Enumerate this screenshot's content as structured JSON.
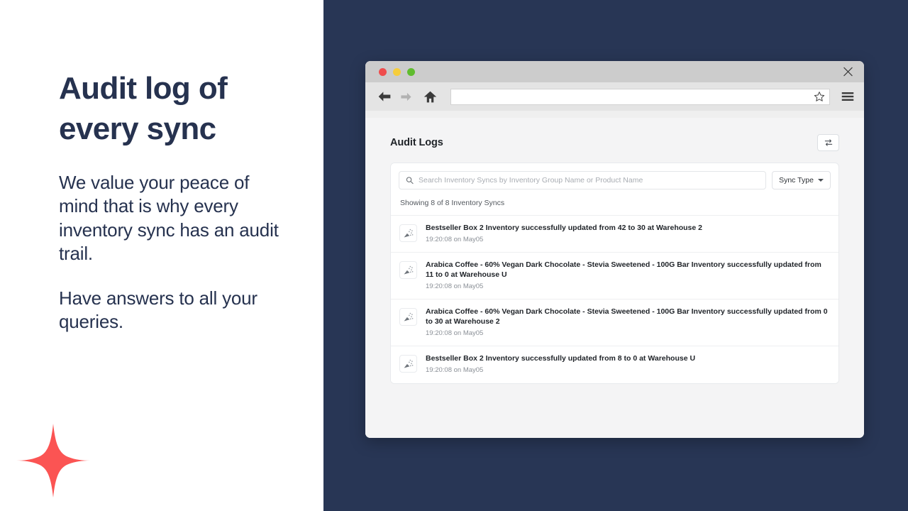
{
  "slide": {
    "headline": "Audit log of every sync",
    "paragraphs": [
      "We value your peace of mind that is why every inventory sync has an audit trail.",
      "Have answers to all your queries."
    ],
    "accent_color": "#fb5453",
    "text_color": "#26324f",
    "panel_color": "#283655",
    "logo_icon": "four-point-sparkle-icon"
  },
  "browser": {
    "traffic_lights": [
      "red",
      "yellow",
      "green"
    ],
    "close_label": "✕",
    "url_value": "",
    "url_placeholder": "",
    "icons": {
      "back": "arrow-left-icon",
      "forward": "arrow-right-icon",
      "home": "home-icon",
      "bookmark": "star-icon",
      "menu": "hamburger-menu-icon"
    }
  },
  "app": {
    "title": "Audit Logs",
    "swap_button_icon": "swap-arrows-icon",
    "search": {
      "value": "",
      "placeholder": "Search Inventory Syncs by Inventory Group Name or Product Name",
      "icon": "search-icon"
    },
    "filter": {
      "label": "Sync Type",
      "icon": "chevron-down-icon"
    },
    "showing_text": "Showing 8 of 8 Inventory Syncs",
    "rows": [
      {
        "icon": "party-popper-icon",
        "message": "Bestseller Box 2 Inventory successfully updated from 42 to 30 at Warehouse 2",
        "timestamp": "19:20:08 on May05"
      },
      {
        "icon": "party-popper-icon",
        "message": "Arabica Coffee - 60% Vegan Dark Chocolate - Stevia Sweetened - 100G Bar Inventory successfully updated from 11 to 0 at Warehouse U",
        "timestamp": "19:20:08 on May05"
      },
      {
        "icon": "party-popper-icon",
        "message": "Arabica Coffee - 60% Vegan Dark Chocolate - Stevia Sweetened - 100G Bar Inventory successfully updated from 0 to 30 at Warehouse 2",
        "timestamp": "19:20:08 on May05"
      },
      {
        "icon": "party-popper-icon",
        "message": "Bestseller Box 2 Inventory successfully updated from 8 to 0 at Warehouse U",
        "timestamp": "19:20:08 on May05"
      }
    ]
  }
}
